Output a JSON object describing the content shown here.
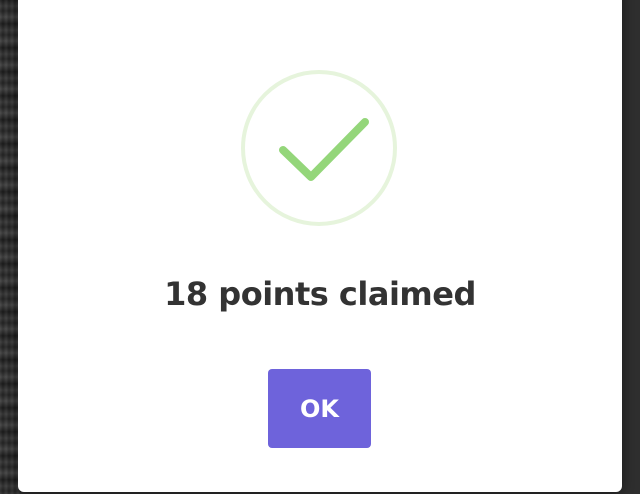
{
  "dialog": {
    "message": "18 points claimed",
    "ok_label": "OK",
    "icon": "checkmark-success-icon"
  },
  "colors": {
    "check": "#94d67a",
    "ring": "#e6f4dc",
    "button": "#6e63db",
    "text": "#333333"
  }
}
